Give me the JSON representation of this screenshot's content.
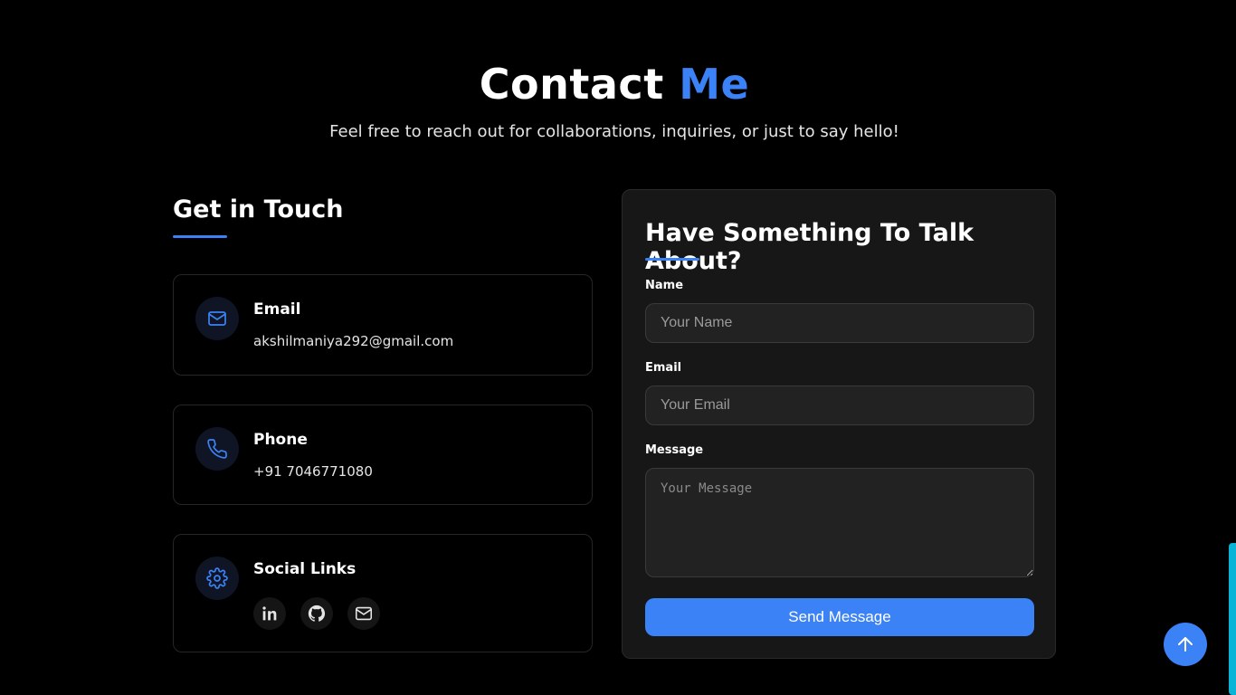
{
  "theme": {
    "accent": "#3b82f6",
    "background": "#000000",
    "scrollbar": "#0ab4d6"
  },
  "header": {
    "title_main": "Contact",
    "title_accent": "Me",
    "subtitle": "Feel free to reach out for collaborations, inquiries, or just to say hello!"
  },
  "contact_info": {
    "heading": "Get in Touch",
    "email": {
      "title": "Email",
      "value": "akshilmaniya292@gmail.com",
      "icon": "mail-icon"
    },
    "phone": {
      "title": "Phone",
      "value": "+91 7046771080",
      "icon": "phone-icon"
    },
    "social": {
      "title": "Social Links",
      "icon": "gear-icon",
      "links": [
        {
          "icon": "linkedin-icon"
        },
        {
          "icon": "github-icon"
        },
        {
          "icon": "mail-icon"
        }
      ]
    }
  },
  "form": {
    "title": "Have Something To Talk About?",
    "name_label": "Name",
    "name_placeholder": "Your Name",
    "email_label": "Email",
    "email_placeholder": "Your Email",
    "message_label": "Message",
    "message_placeholder": "Your Message",
    "submit_label": "Send Message"
  },
  "scroll_top": {
    "icon": "arrow-up-icon"
  }
}
